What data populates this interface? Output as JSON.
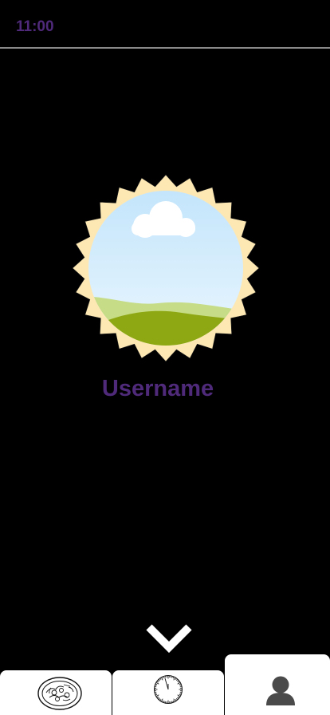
{
  "status_bar": {
    "time": "11:00"
  },
  "profile": {
    "username": "Username"
  },
  "tabs": [
    {
      "icon": "food-plate-icon"
    },
    {
      "icon": "clock-icon"
    },
    {
      "icon": "person-icon",
      "selected": true
    }
  ],
  "colors": {
    "accent": "#4f2a7a",
    "background": "#000000",
    "badge": "#fde8b4"
  }
}
